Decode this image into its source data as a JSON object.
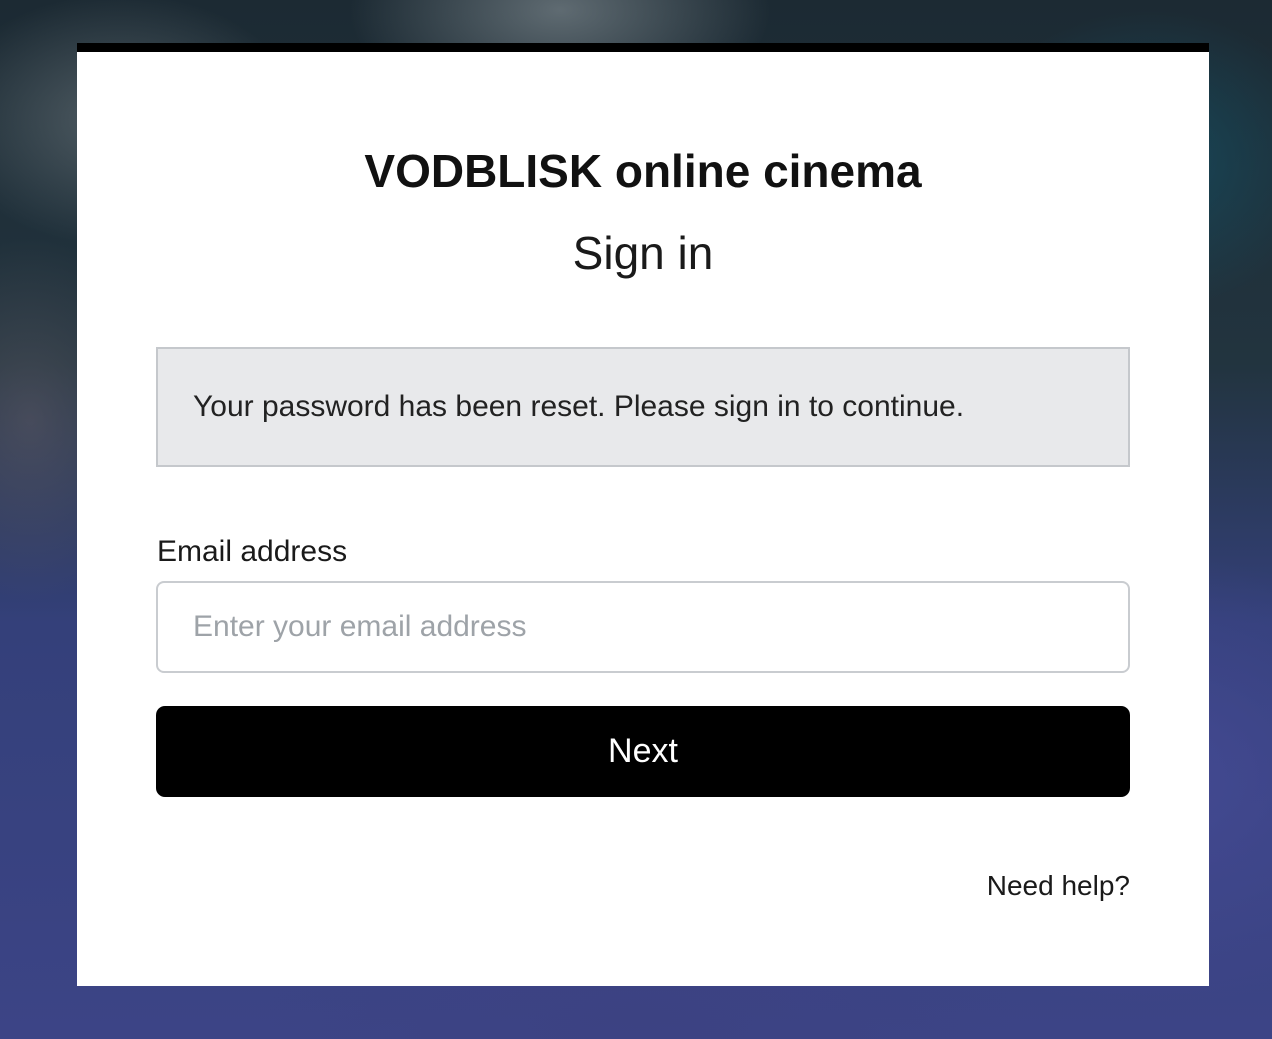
{
  "brand": {
    "title": "VODBLISK online cinema"
  },
  "page": {
    "heading": "Sign in"
  },
  "alert": {
    "message": "Your password has been reset. Please sign in to continue."
  },
  "form": {
    "email_label": "Email address",
    "email_placeholder": "Enter your email address",
    "email_value": "",
    "next_label": "Next"
  },
  "footer": {
    "help_label": "Need help?"
  },
  "colors": {
    "accent": "#000000",
    "alert_background": "#e8e9eb",
    "card_background": "#ffffff"
  }
}
